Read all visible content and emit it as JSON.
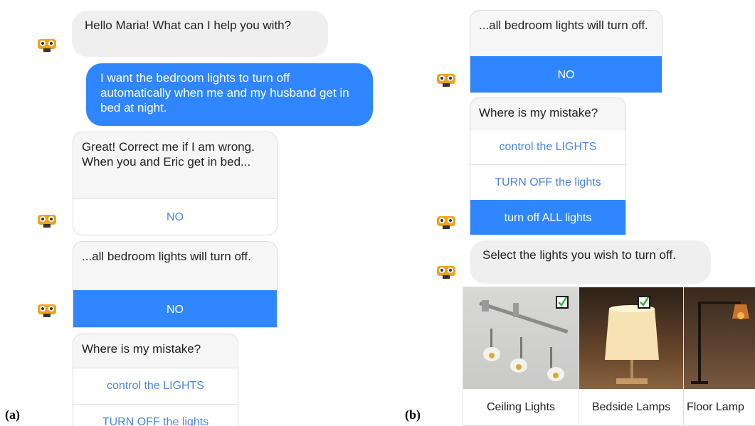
{
  "panel_a": {
    "label": "(a)",
    "greeting": "Hello Maria! What can I help you with?",
    "user_message": "I want the bedroom lights to turn off automatically when me and my husband get in bed at night.",
    "confirm_card": {
      "text": "Great! Correct me if I am wrong. When you and Eric get in bed...",
      "option": "NO"
    },
    "action_card": {
      "text": "...all bedroom lights will turn off.",
      "option": "NO"
    },
    "mistake_card": {
      "text": "Where is my mistake?",
      "options": [
        "control the LIGHTS",
        "TURN OFF the lights"
      ]
    }
  },
  "panel_b": {
    "label": "(b)",
    "action_card": {
      "text": "...all bedroom lights will turn off.",
      "option": "NO"
    },
    "mistake_card": {
      "text": "Where is my mistake?",
      "options": [
        "control the LIGHTS",
        "TURN OFF the lights",
        "turn off ALL lights"
      ]
    },
    "select_message": "Select the lights you wish to turn off.",
    "products": [
      {
        "name": "Ceiling Lights",
        "checked": true
      },
      {
        "name": "Bedside Lamps",
        "checked": true
      },
      {
        "name": "Floor Lamp",
        "checked": false
      }
    ]
  },
  "colors": {
    "accent_blue": "#2f86ff",
    "option_text": "#4a86e8",
    "bubble_grey": "#efefef",
    "bot_orange": "#f0a21b",
    "check_green": "#2db82d"
  },
  "icons": {
    "bot": "robot-face-icon",
    "check": "checkbox-checked-icon"
  }
}
